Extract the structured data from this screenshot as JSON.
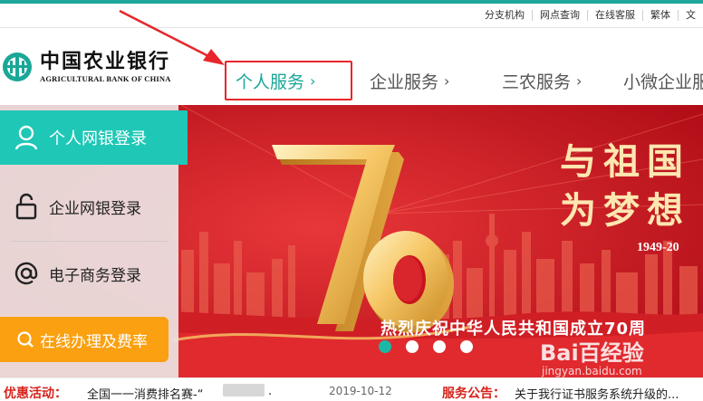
{
  "utility_nav": [
    "分支机构",
    "网点查询",
    "在线客服",
    "繁体",
    "|",
    "文"
  ],
  "logo": {
    "cn": "中国农业银行",
    "en": "AGRICULTURAL BANK OF CHINA"
  },
  "main_nav": [
    {
      "label": "个人服务",
      "chevron": "›",
      "active": true
    },
    {
      "label": "企业服务",
      "chevron": "›",
      "active": false
    },
    {
      "label": "三农服务",
      "chevron": "›",
      "active": false
    },
    {
      "label": "小微企业服",
      "chevron": "",
      "active": false
    }
  ],
  "login_panel": {
    "personal": {
      "label": "个人网银登录",
      "icon": "user-icon"
    },
    "corporate": {
      "label": "企业网银登录",
      "icon": "lock-icon"
    },
    "ecommerce": {
      "label": "电子商务登录",
      "icon": "at-icon"
    },
    "online": {
      "label": "在线办理及费率",
      "icon": "search-icon"
    }
  },
  "banner": {
    "big_number": "70",
    "title_line1": "与祖国",
    "title_line2": "为梦想",
    "years": "1949-20",
    "caption": "热烈庆祝中华人民共和国成立70周",
    "slides": 4,
    "active_slide": 0
  },
  "watermark": {
    "brand": "Bai百经验",
    "url": "jingyan.baidu.com"
  },
  "ticker": {
    "promo_label": "优惠活动：",
    "promo_text": "全国一一消费排名赛-“",
    "promo_tail": ".",
    "date": "2019-10-12",
    "notice_label": "服务公告：",
    "notice_text": "关于我行证书服务系统升级的..."
  },
  "colors": {
    "brand_teal": "#1aa797",
    "login_teal": "#1ec7b6",
    "banner_red": "#c8141d",
    "gold": "#f6c766",
    "orange": "#fba010",
    "annotation_red": "#e8262b"
  }
}
